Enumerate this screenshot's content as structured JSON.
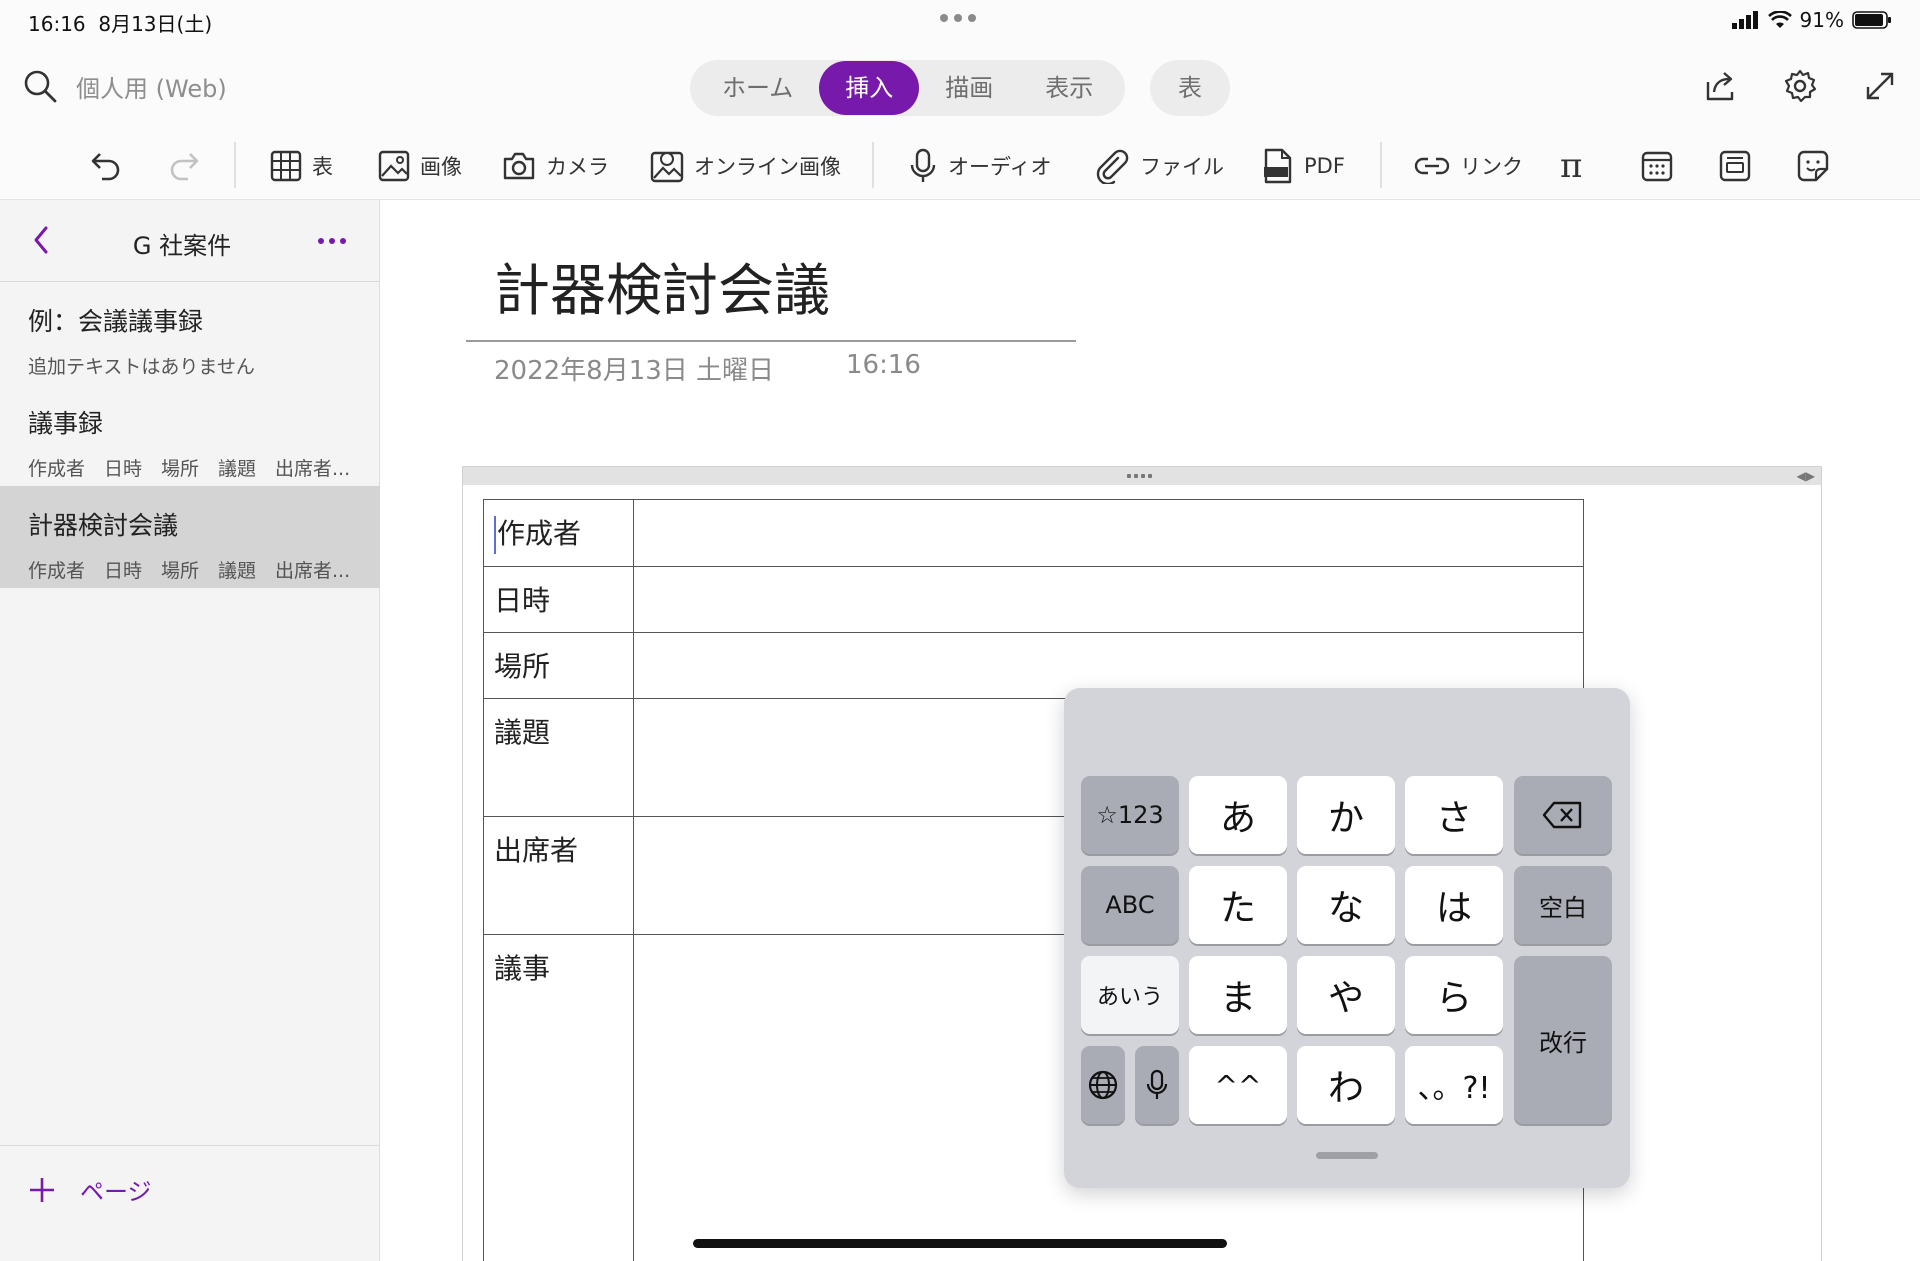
{
  "status_bar": {
    "time": "16:16",
    "date": "8月13日(土)",
    "battery": "91%"
  },
  "header": {
    "notebook": "個人用 (Web)",
    "tabs": [
      {
        "label": "ホーム",
        "active": false
      },
      {
        "label": "挿入",
        "active": true
      },
      {
        "label": "描画",
        "active": false
      },
      {
        "label": "表示",
        "active": false
      }
    ],
    "context_tab": "表",
    "accent_color": "#7719aa"
  },
  "toolbar": {
    "table": "表",
    "image": "画像",
    "camera": "カメラ",
    "online_image": "オンライン画像",
    "audio": "オーディオ",
    "file": "ファイル",
    "pdf": "PDF",
    "link": "リンク",
    "equation_icon": "π"
  },
  "sidebar": {
    "section_title": "G 社案件",
    "pages": [
      {
        "title": "例：会議議事録",
        "preview": "追加テキストはありません",
        "selected": false
      },
      {
        "title": "議事録",
        "preview": "作成者　日時　場所　議題　出席者...",
        "selected": false
      },
      {
        "title": "計器検討会議",
        "preview": "作成者　日時　場所　議題　出席者...",
        "selected": true
      }
    ],
    "add_page": "ページ"
  },
  "page": {
    "title": "計器検討会議",
    "date": "2022年8月13日 土曜日",
    "time": "16:16",
    "table": {
      "rows": [
        {
          "label": "作成者",
          "value": ""
        },
        {
          "label": "日時",
          "value": ""
        },
        {
          "label": "場所",
          "value": ""
        },
        {
          "label": "議題",
          "value": ""
        },
        {
          "label": "出席者",
          "value": ""
        },
        {
          "label": "議事",
          "value": ""
        }
      ]
    }
  },
  "keyboard": {
    "mode_num": "☆123",
    "mode_abc": "ABC",
    "mode_kana": "あいう",
    "space": "空白",
    "return": "改行",
    "kana": [
      "あ",
      "か",
      "さ",
      "た",
      "な",
      "は",
      "ま",
      "や",
      "ら",
      "^^",
      "わ",
      "、。?!"
    ]
  }
}
